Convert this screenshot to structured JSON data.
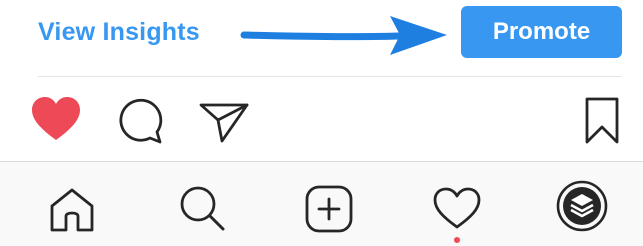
{
  "post_header": {
    "view_insights_label": "View Insights",
    "promote_label": "Promote"
  },
  "action_bar": {
    "like": {
      "icon": "heart-icon",
      "liked": true
    },
    "comment": {
      "icon": "comment-icon"
    },
    "share": {
      "icon": "paper-plane-icon"
    },
    "save": {
      "icon": "bookmark-icon"
    }
  },
  "tab_bar": {
    "items": [
      {
        "icon": "home-icon"
      },
      {
        "icon": "search-icon"
      },
      {
        "icon": "new-post-icon"
      },
      {
        "icon": "activity-heart-icon",
        "has_notification": true
      },
      {
        "icon": "profile-layers-icon"
      }
    ]
  },
  "colors": {
    "link_blue": "#3897f0",
    "arrow_blue": "#1f7fe0",
    "promote_bg": "#3897f0",
    "like_red": "#ed4956",
    "icon_dark": "#262626",
    "notification_dot": "#ed4956"
  }
}
